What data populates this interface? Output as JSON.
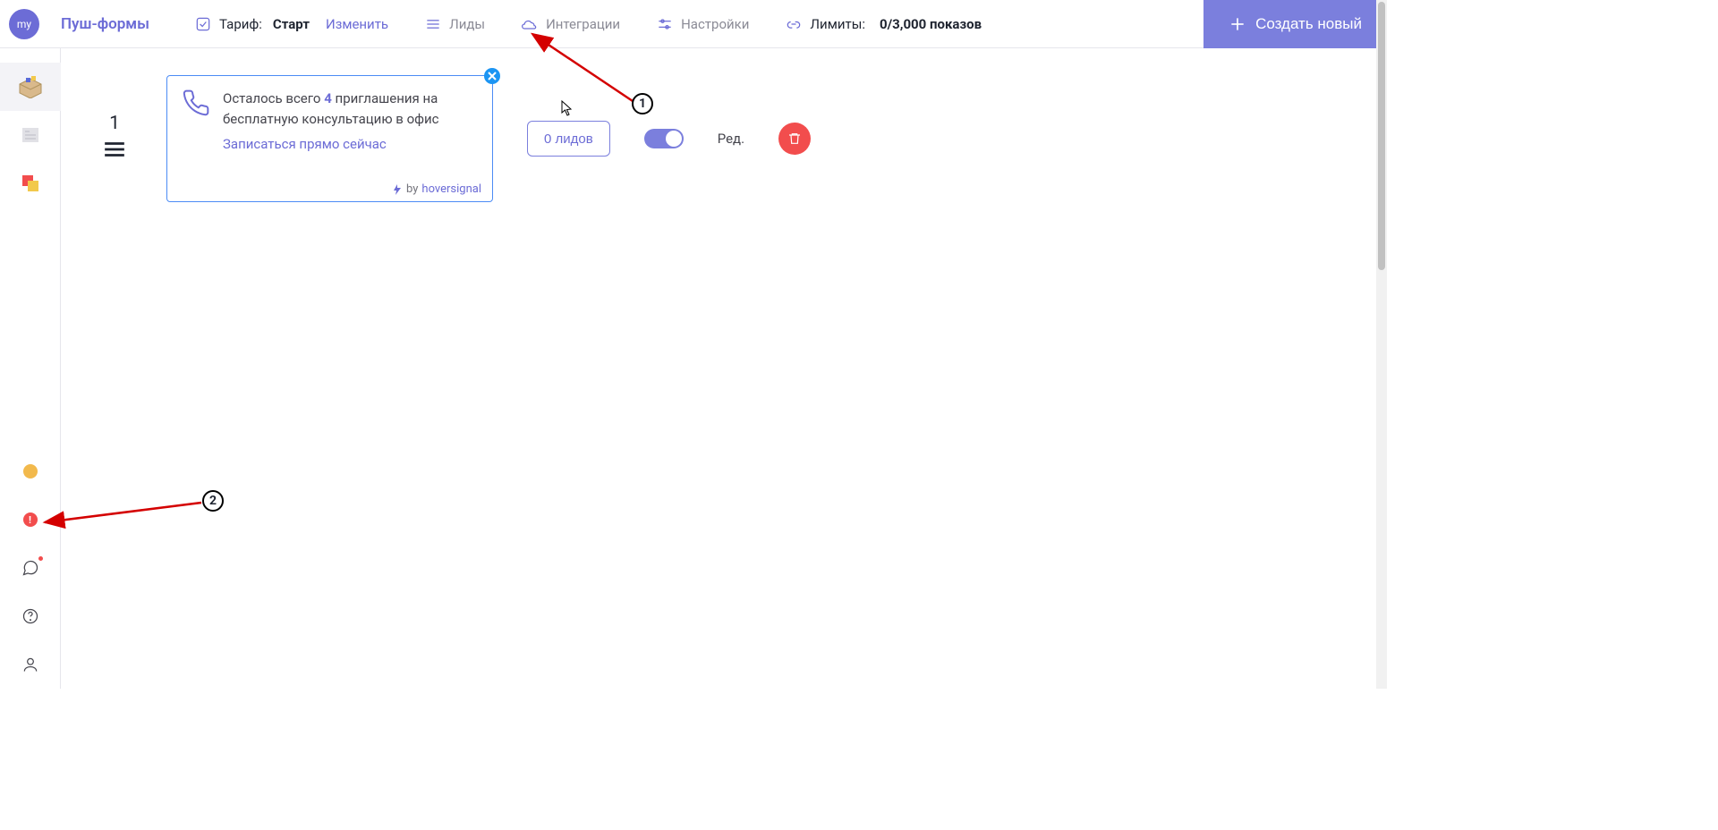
{
  "avatar_text": "my",
  "brand": "Пуш-формы",
  "tariff": {
    "label": "Тариф:",
    "plan": "Старт",
    "change": "Изменить"
  },
  "nav": {
    "leads": "Лиды",
    "integrations": "Интеграции",
    "settings": "Настройки"
  },
  "limits": {
    "label": "Лимиты:",
    "value": "0/3,000 показов"
  },
  "create_btn": "Создать новый",
  "row_index": "1",
  "card": {
    "line_a": "Осталось всего",
    "count": "4",
    "line_b": "приглашения на бесплатную консультацию в офис",
    "cta": "Записаться прямо сейчас",
    "by_prefix": "by",
    "by_link": "hoversignal"
  },
  "controls": {
    "leads_btn": "0 лидов",
    "edit": "Ред."
  },
  "markers": {
    "one": "1",
    "two": "2"
  }
}
